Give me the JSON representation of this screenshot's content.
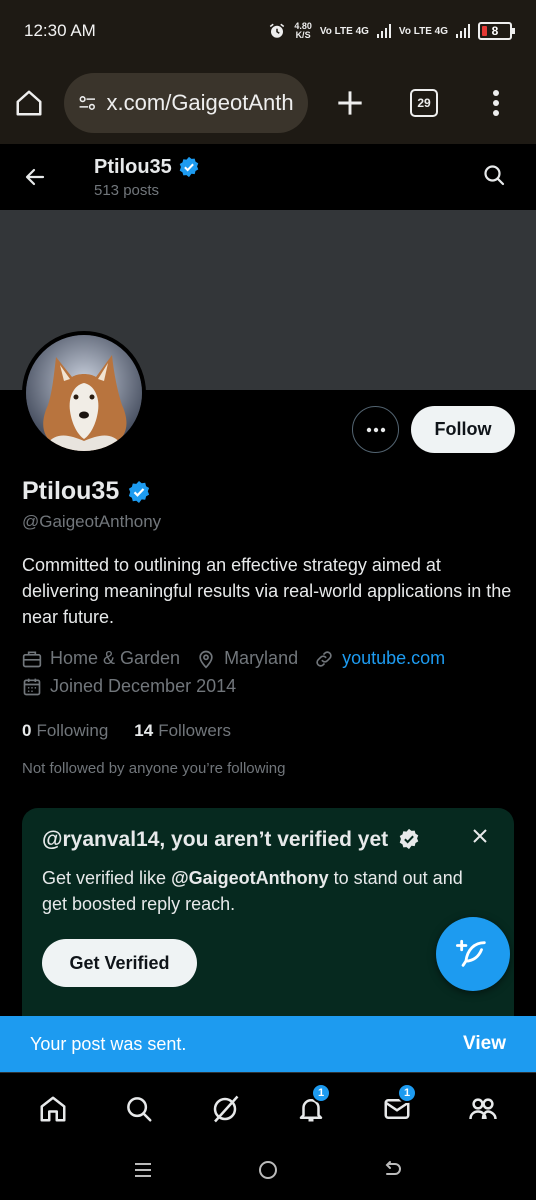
{
  "status_bar": {
    "time": "12:30 AM",
    "speed_value": "4.80",
    "speed_unit": "K/S",
    "sim1": "Vo LTE 4G",
    "sim2": "Vo LTE 4G",
    "battery": "8"
  },
  "browser": {
    "url": "x.com/GaigeotAnthony",
    "tab_count": "29"
  },
  "header": {
    "name": "Ptilou35",
    "posts": "513 posts"
  },
  "profile": {
    "display_name": "Ptilou35",
    "handle": "@GaigeotAnthony",
    "bio": "Committed to outlining an effective strategy aimed at delivering meaningful results via real-world applications in the near future.",
    "category": "Home & Garden",
    "location": "Maryland",
    "website": "youtube.com",
    "joined": "Joined December 2014",
    "following_count": "0",
    "following_label": "Following",
    "followers_count": "14",
    "followers_label": "Followers",
    "not_followed": "Not followed by anyone you’re following",
    "follow_label": "Follow"
  },
  "verify_card": {
    "title": "@ryanval14, you aren’t verified yet",
    "text_prefix": "Get verified like ",
    "text_handle": "@GaigeotAnthony",
    "text_suffix": " to stand out and get boosted reply reach.",
    "button": "Get Verified"
  },
  "toast": {
    "message": "Your post was sent.",
    "action": "View"
  },
  "bottom_nav": {
    "notifications_badge": "1",
    "messages_badge": "1"
  },
  "colors": {
    "accent": "#1d9bf0",
    "background": "#000000",
    "card": "#06291f",
    "muted": "#71767b"
  }
}
